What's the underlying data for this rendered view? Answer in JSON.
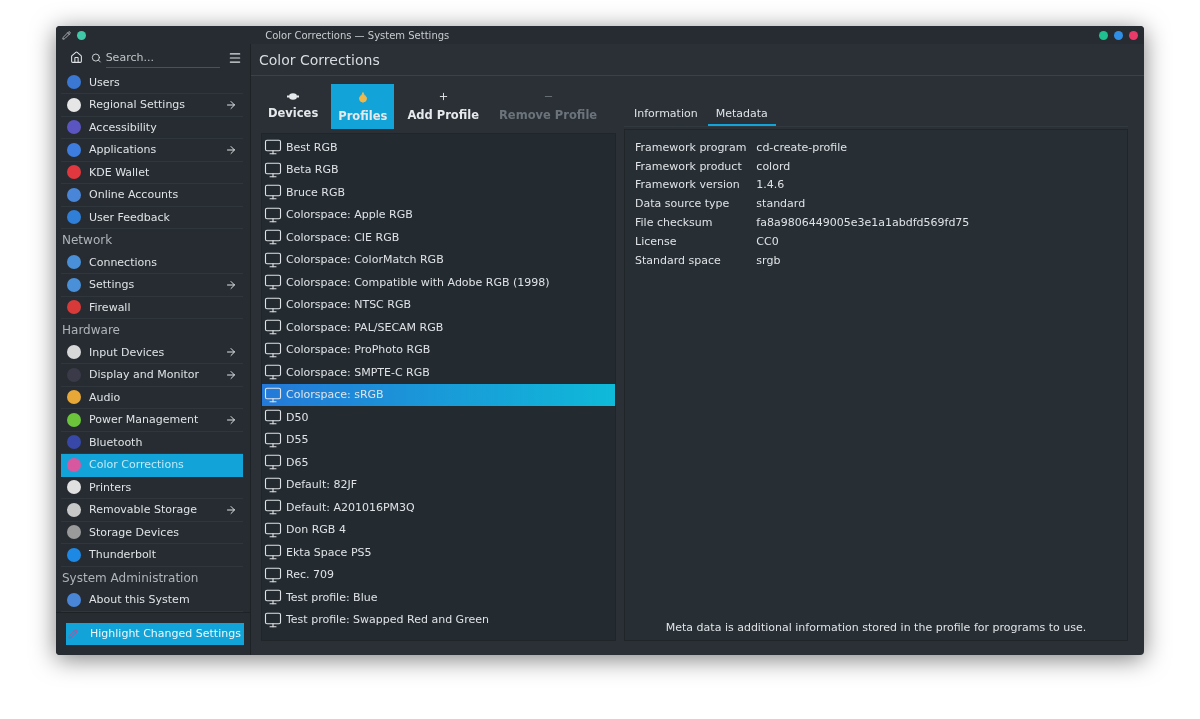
{
  "window": {
    "title": "Color Corrections — System Settings"
  },
  "sidebar": {
    "search": {
      "placeholder": "Search..."
    },
    "items": [
      {
        "kind": "item",
        "label": "Users",
        "color": "#3b78d4",
        "arrow": false,
        "selected": false
      },
      {
        "kind": "item",
        "label": "Regional Settings",
        "color": "#e6e6e6",
        "arrow": true,
        "selected": false
      },
      {
        "kind": "item",
        "label": "Accessibility",
        "color": "#5a55c0",
        "arrow": false,
        "selected": false
      },
      {
        "kind": "item",
        "label": "Applications",
        "color": "#3d7de0",
        "arrow": true,
        "selected": false
      },
      {
        "kind": "item",
        "label": "KDE Wallet",
        "color": "#e0383e",
        "arrow": false,
        "selected": false
      },
      {
        "kind": "item",
        "label": "Online Accounts",
        "color": "#4a86d8",
        "arrow": false,
        "selected": false
      },
      {
        "kind": "item",
        "label": "User Feedback",
        "color": "#2f7fd8",
        "arrow": false,
        "selected": false
      },
      {
        "kind": "header",
        "label": "Network"
      },
      {
        "kind": "item",
        "label": "Connections",
        "color": "#4a90d8",
        "arrow": false,
        "selected": false
      },
      {
        "kind": "item",
        "label": "Settings",
        "color": "#4a90d8",
        "arrow": true,
        "selected": false
      },
      {
        "kind": "item",
        "label": "Firewall",
        "color": "#d83a3a",
        "arrow": false,
        "selected": false
      },
      {
        "kind": "header",
        "label": "Hardware"
      },
      {
        "kind": "item",
        "label": "Input Devices",
        "color": "#d8d8d8",
        "arrow": true,
        "selected": false
      },
      {
        "kind": "item",
        "label": "Display and Monitor",
        "color": "#3a3a48",
        "arrow": true,
        "selected": false
      },
      {
        "kind": "item",
        "label": "Audio",
        "color": "#e8a838",
        "arrow": false,
        "selected": false
      },
      {
        "kind": "item",
        "label": "Power Management",
        "color": "#6bc43a",
        "arrow": true,
        "selected": false
      },
      {
        "kind": "item",
        "label": "Bluetooth",
        "color": "#3848a8",
        "arrow": false,
        "selected": false
      },
      {
        "kind": "item",
        "label": "Color Corrections",
        "color": "#d858a0",
        "arrow": false,
        "selected": true
      },
      {
        "kind": "item",
        "label": "Printers",
        "color": "#e0e0e0",
        "arrow": false,
        "selected": false
      },
      {
        "kind": "item",
        "label": "Removable Storage",
        "color": "#c8c8c8",
        "arrow": true,
        "selected": false
      },
      {
        "kind": "item",
        "label": "Storage Devices",
        "color": "#9a9a9a",
        "arrow": false,
        "selected": false
      },
      {
        "kind": "item",
        "label": "Thunderbolt",
        "color": "#1e88e5",
        "arrow": false,
        "selected": false
      },
      {
        "kind": "header",
        "label": "System Administration"
      },
      {
        "kind": "item",
        "label": "About this System",
        "color": "#4a86d8",
        "arrow": false,
        "selected": false
      }
    ],
    "highlight_button": "Highlight Changed Settings"
  },
  "page": {
    "title": "Color Corrections",
    "toolbar": [
      {
        "kind": "devices",
        "label": "Devices",
        "selected": false,
        "disabled": false
      },
      {
        "kind": "profiles",
        "label": "Profiles",
        "selected": true,
        "disabled": false
      },
      {
        "kind": "add",
        "label": "Add Profile",
        "selected": false,
        "disabled": false
      },
      {
        "kind": "remove",
        "label": "Remove Profile",
        "selected": false,
        "disabled": true
      }
    ],
    "profiles": [
      {
        "name": "Best RGB",
        "selected": false
      },
      {
        "name": "Beta RGB",
        "selected": false
      },
      {
        "name": "Bruce RGB",
        "selected": false
      },
      {
        "name": "Colorspace: Apple RGB",
        "selected": false
      },
      {
        "name": "Colorspace: CIE RGB",
        "selected": false
      },
      {
        "name": "Colorspace: ColorMatch RGB",
        "selected": false
      },
      {
        "name": "Colorspace: Compatible with Adobe RGB (1998)",
        "selected": false
      },
      {
        "name": "Colorspace: NTSC RGB",
        "selected": false
      },
      {
        "name": "Colorspace: PAL/SECAM RGB",
        "selected": false
      },
      {
        "name": "Colorspace: ProPhoto RGB",
        "selected": false
      },
      {
        "name": "Colorspace: SMPTE-C RGB",
        "selected": false
      },
      {
        "name": "Colorspace: sRGB",
        "selected": true
      },
      {
        "name": "D50",
        "selected": false
      },
      {
        "name": "D55",
        "selected": false
      },
      {
        "name": "D65",
        "selected": false
      },
      {
        "name": "Default: 82JF",
        "selected": false
      },
      {
        "name": "Default: A201016PM3Q",
        "selected": false
      },
      {
        "name": "Don RGB 4",
        "selected": false
      },
      {
        "name": "Ekta Space PS5",
        "selected": false
      },
      {
        "name": "Rec. 709",
        "selected": false
      },
      {
        "name": "Test profile: Blue",
        "selected": false
      },
      {
        "name": "Test profile: Swapped Red and Green",
        "selected": false
      }
    ],
    "details": {
      "tabs": [
        {
          "label": "Information",
          "selected": false
        },
        {
          "label": "Metadata",
          "selected": true
        }
      ],
      "rows": [
        {
          "label": "Framework program",
          "value": "cd-create-profile"
        },
        {
          "label": "Framework product",
          "value": "colord"
        },
        {
          "label": "Framework version",
          "value": "1.4.6"
        },
        {
          "label": "Data source type",
          "value": "standard"
        },
        {
          "label": "File checksum",
          "value": "fa8a9806449005e3e1a1abdfd569fd75"
        },
        {
          "label": "License",
          "value": "CC0"
        },
        {
          "label": "Standard space",
          "value": "srgb"
        }
      ],
      "note": "Meta data is additional information stored in the profile for programs to use."
    }
  }
}
